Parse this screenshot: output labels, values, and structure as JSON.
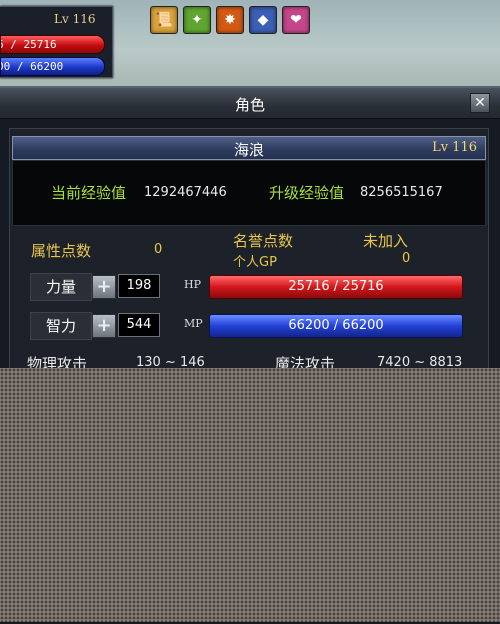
{
  "hud": {
    "level": "Lv 116",
    "hp_text": "6 / 25716",
    "mp_text": "00 / 66200"
  },
  "buffs": [
    {
      "name": "scroll-buff-icon",
      "color": "#d9a23a",
      "glyph": "📜"
    },
    {
      "name": "nature-buff-icon",
      "color": "#5fa52f",
      "glyph": "✦"
    },
    {
      "name": "fire-buff-icon",
      "color": "#d45a14",
      "glyph": "✸"
    },
    {
      "name": "gem-buff-icon",
      "color": "#3c5fb6",
      "glyph": "◆"
    },
    {
      "name": "heart-buff-icon",
      "color": "#c6468a",
      "glyph": "❤"
    }
  ],
  "window": {
    "title": "角色",
    "close_label": "✕"
  },
  "character": {
    "name": "海浪",
    "level": "Lv 116"
  },
  "experience": {
    "current_label": "当前经验值",
    "current_value": "1292467446",
    "next_label": "升级经验值",
    "next_value": "8256515167"
  },
  "points": {
    "attr_label": "属性点数",
    "attr_value": "0",
    "honor_label": "名誉点数",
    "honor_value": "未加入",
    "gp_label": "个人GP",
    "gp_value": "0"
  },
  "stats": {
    "str_label": "力量",
    "str_value": "198",
    "hp_label": "HP",
    "hp_text": "25716 / 25716",
    "int_label": "智力",
    "int_value": "544",
    "mp_label": "MP",
    "mp_text": "66200 / 66200"
  },
  "attack": {
    "phys_label": "物理攻击",
    "phys_value": "130 ~ 146",
    "magic_label": "魔法攻击",
    "magic_value": "7420 ~ 8813"
  },
  "colors": {
    "hp": "#d3171b",
    "mp": "#2342d8",
    "gold": "#e9c64a",
    "green": "#a8e03a"
  }
}
